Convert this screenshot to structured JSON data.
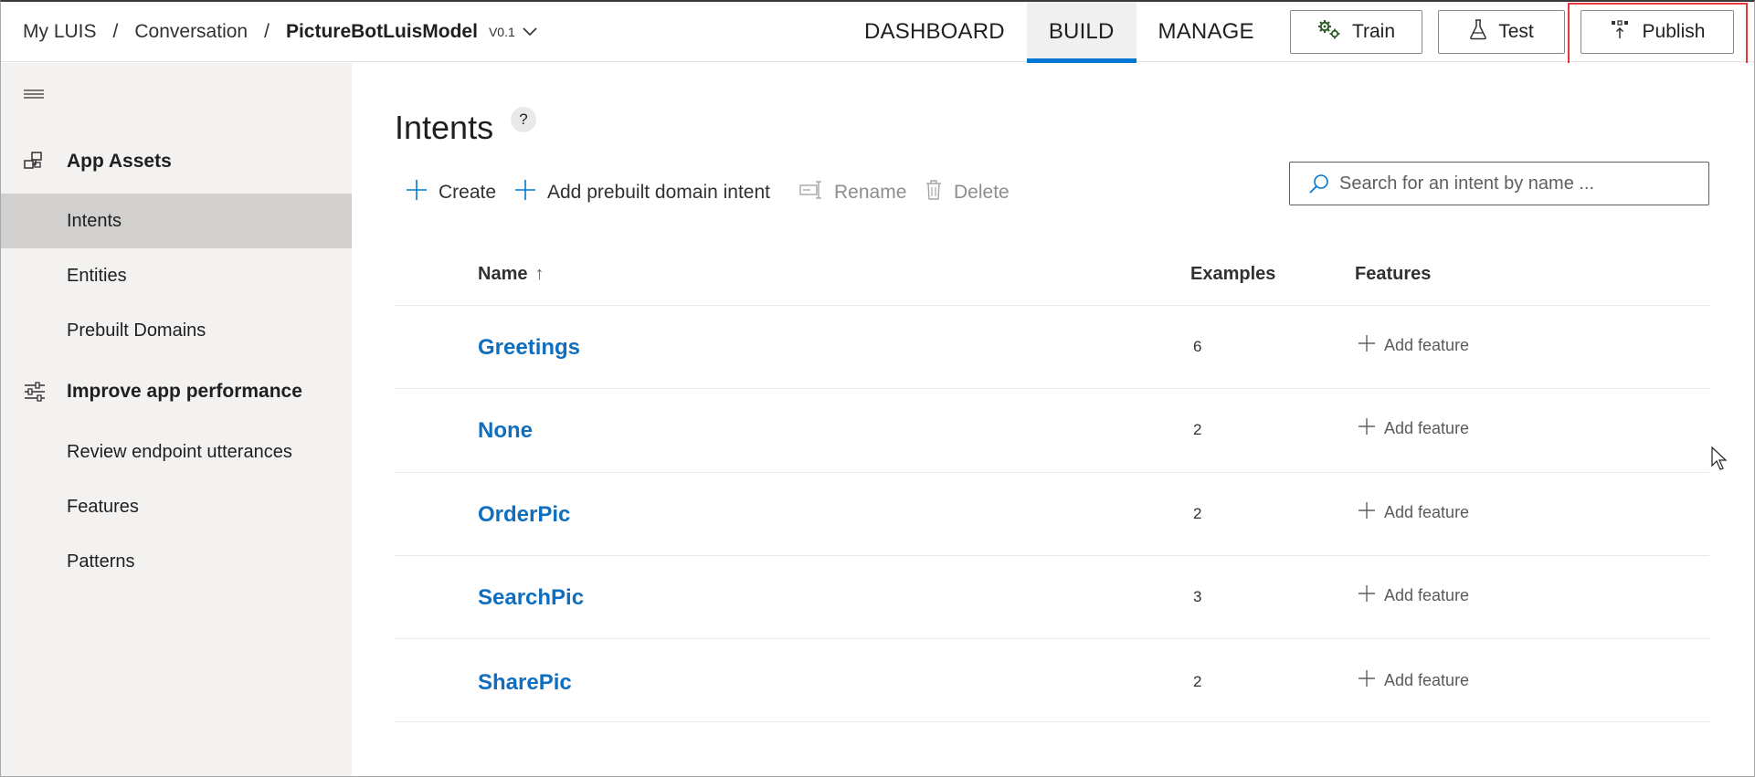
{
  "breadcrumb": {
    "root": "My LUIS",
    "section": "Conversation",
    "app_name": "PictureBotLuisModel",
    "version": "V0.1",
    "separator": "/"
  },
  "nav": {
    "tabs": [
      {
        "label": "DASHBOARD",
        "active": false
      },
      {
        "label": "BUILD",
        "active": true
      },
      {
        "label": "MANAGE",
        "active": false
      }
    ]
  },
  "actions": {
    "train": "Train",
    "test": "Test",
    "publish": "Publish"
  },
  "sidebar": {
    "sections": [
      {
        "title": "App Assets",
        "icon": "app-assets-icon",
        "items": [
          {
            "label": "Intents",
            "active": true
          },
          {
            "label": "Entities",
            "active": false
          },
          {
            "label": "Prebuilt Domains",
            "active": false
          }
        ]
      },
      {
        "title": "Improve app performance",
        "icon": "sliders-icon",
        "items": [
          {
            "label": "Review endpoint utterances",
            "active": false
          },
          {
            "label": "Features",
            "active": false
          },
          {
            "label": "Patterns",
            "active": false
          }
        ]
      }
    ]
  },
  "page": {
    "title": "Intents",
    "help": "?"
  },
  "commands": {
    "create": "Create",
    "add_prebuilt": "Add prebuilt domain intent",
    "rename": "Rename",
    "delete": "Delete"
  },
  "search": {
    "placeholder": "Search for an intent by name ..."
  },
  "table": {
    "columns": {
      "name": "Name",
      "sort_indicator": "↑",
      "examples": "Examples",
      "features": "Features"
    },
    "rows": [
      {
        "name": "Greetings",
        "examples": "6",
        "action": "Add feature"
      },
      {
        "name": "None",
        "examples": "2",
        "action": "Add feature"
      },
      {
        "name": "OrderPic",
        "examples": "2",
        "action": "Add feature"
      },
      {
        "name": "SearchPic",
        "examples": "3",
        "action": "Add feature"
      },
      {
        "name": "SharePic",
        "examples": "2",
        "action": "Add feature"
      }
    ]
  },
  "colors": {
    "accent": "#0078d4",
    "link": "#106ebe",
    "highlight": "#e8383d",
    "sidebar_bg": "#f3f2f1",
    "sidebar_active": "#d2d0ce"
  }
}
